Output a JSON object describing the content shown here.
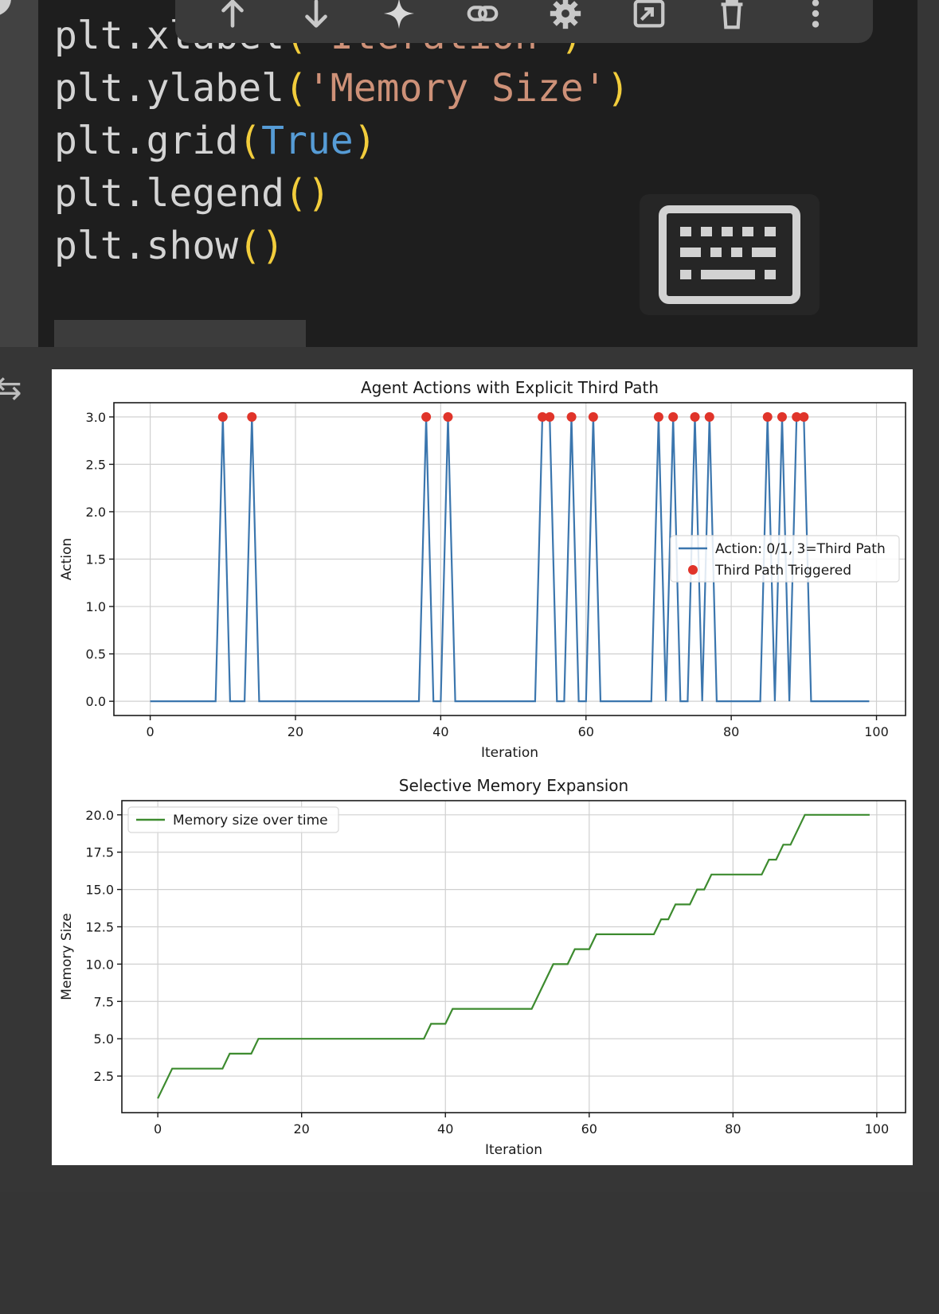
{
  "code_cell": {
    "lines": [
      [
        {
          "t": "plt.xlabel",
          "c": "plain"
        },
        {
          "t": "(",
          "c": "punc"
        },
        {
          "t": "'Iteration'",
          "c": "str"
        },
        {
          "t": ")",
          "c": "punc"
        }
      ],
      [
        {
          "t": "plt.ylabel",
          "c": "plain"
        },
        {
          "t": "(",
          "c": "punc"
        },
        {
          "t": "'Memory Size'",
          "c": "str"
        },
        {
          "t": ")",
          "c": "punc"
        }
      ],
      [
        {
          "t": "plt.grid",
          "c": "plain"
        },
        {
          "t": "(",
          "c": "punc"
        },
        {
          "t": "True",
          "c": "kw"
        },
        {
          "t": ")",
          "c": "punc"
        }
      ],
      [
        {
          "t": "plt.legend",
          "c": "plain"
        },
        {
          "t": "()",
          "c": "punc"
        }
      ],
      [
        {
          "t": "plt.show",
          "c": "plain"
        },
        {
          "t": "()",
          "c": "punc"
        }
      ]
    ]
  },
  "toolbar": {
    "icons": [
      "move-up-icon",
      "move-down-icon",
      "sparkle-icon",
      "link-icon",
      "gear-icon",
      "open-in-editor-icon",
      "delete-icon",
      "more-vert-icon"
    ]
  },
  "keyboard_button": {
    "icon": "keyboard-icon"
  },
  "colors": {
    "action_line": "#3b76ae",
    "third_path_marker": "#e0342a",
    "memory_line": "#3d8b2f",
    "grid": "#d0d0d0"
  },
  "chart_data": [
    {
      "type": "line",
      "title": "Agent Actions with Explicit Third Path",
      "xlabel": "Iteration",
      "ylabel": "Action",
      "xlim": [
        -5,
        104
      ],
      "ylim": [
        -0.15,
        3.15
      ],
      "xticks": [
        0,
        20,
        40,
        60,
        80,
        100
      ],
      "yticks": [
        0.0,
        0.5,
        1.0,
        1.5,
        2.0,
        2.5,
        3.0
      ],
      "ytick_labels": [
        "0.0",
        "0.5",
        "1.0",
        "1.5",
        "2.0",
        "2.5",
        "3.0"
      ],
      "grid": true,
      "legend_position": "center-right",
      "series": [
        {
          "name": "Action: 0/1, 3=Third Path",
          "kind": "line",
          "x_range": [
            0,
            99
          ],
          "baseline": 0,
          "spikes_at": [
            10,
            14,
            38,
            41,
            54,
            55,
            58,
            61,
            70,
            72,
            75,
            77,
            85,
            87,
            89,
            90
          ],
          "spike_value": 3
        },
        {
          "name": "Third Path Triggered",
          "kind": "scatter",
          "x": [
            10,
            14,
            38,
            41,
            54,
            55,
            58,
            61,
            70,
            72,
            75,
            77,
            85,
            87,
            89,
            90
          ],
          "y": [
            3,
            3,
            3,
            3,
            3,
            3,
            3,
            3,
            3,
            3,
            3,
            3,
            3,
            3,
            3,
            3
          ]
        }
      ]
    },
    {
      "type": "line",
      "title": "Selective Memory Expansion",
      "xlabel": "Iteration",
      "ylabel": "Memory Size",
      "xlim": [
        -5,
        104
      ],
      "ylim": [
        0.05,
        20.95
      ],
      "xticks": [
        0,
        20,
        40,
        60,
        80,
        100
      ],
      "yticks": [
        2.5,
        5.0,
        7.5,
        10.0,
        12.5,
        15.0,
        17.5,
        20.0
      ],
      "ytick_labels": [
        "2.5",
        "5.0",
        "7.5",
        "10.0",
        "12.5",
        "15.0",
        "17.5",
        "20.0"
      ],
      "grid": true,
      "legend_position": "top-left",
      "series": [
        {
          "name": "Memory size over time",
          "kind": "line",
          "x": [
            0,
            2,
            9,
            10,
            13,
            14,
            37,
            38,
            40,
            41,
            52,
            55,
            57,
            58,
            60,
            61,
            69,
            70,
            71,
            72,
            74,
            75,
            76,
            77,
            84,
            85,
            86,
            87,
            88,
            90,
            99
          ],
          "y": [
            1,
            3,
            3,
            4,
            4,
            5,
            5,
            6,
            6,
            7,
            7,
            10,
            10,
            11,
            11,
            12,
            12,
            13,
            13,
            14,
            14,
            15,
            15,
            16,
            16,
            17,
            17,
            18,
            18,
            20,
            20
          ]
        }
      ]
    }
  ]
}
